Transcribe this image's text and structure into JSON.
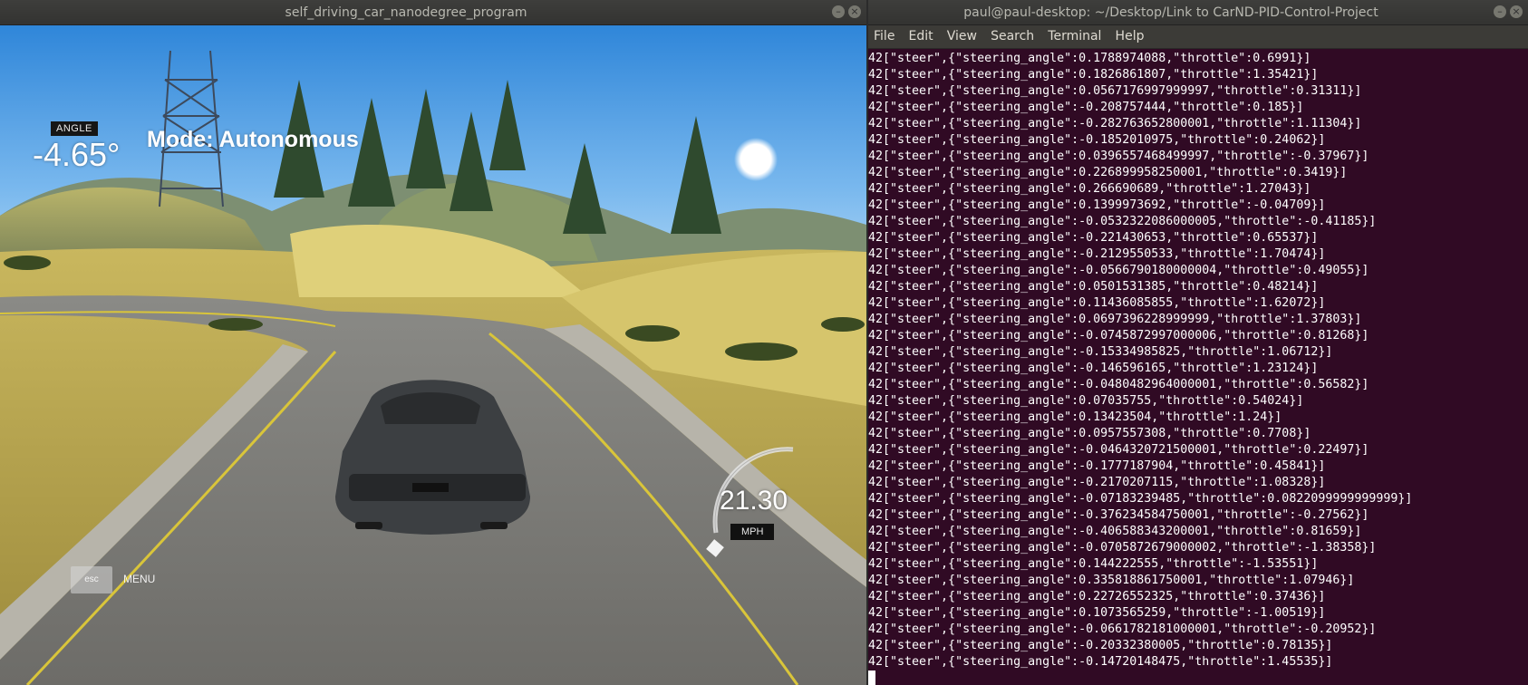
{
  "simulator": {
    "title": "self_driving_car_nanodegree_program",
    "angle_label": "ANGLE",
    "angle_value": "-4.65°",
    "mode": "Mode: Autonomous",
    "speed": "21.30",
    "speed_unit": "MPH",
    "esc_label": "esc",
    "menu_label": "MENU"
  },
  "terminal": {
    "title": "paul@paul-desktop: ~/Desktop/Link to CarND-PID-Control-Project",
    "menu": [
      "File",
      "Edit",
      "View",
      "Search",
      "Terminal",
      "Help"
    ],
    "lines": [
      "42[\"steer\",{\"steering_angle\":0.1788974088,\"throttle\":0.6991}]",
      "42[\"steer\",{\"steering_angle\":0.1826861807,\"throttle\":1.35421}]",
      "42[\"steer\",{\"steering_angle\":0.0567176997999997,\"throttle\":0.31311}]",
      "42[\"steer\",{\"steering_angle\":-0.208757444,\"throttle\":0.185}]",
      "42[\"steer\",{\"steering_angle\":-0.282763652800001,\"throttle\":1.11304}]",
      "42[\"steer\",{\"steering_angle\":-0.1852010975,\"throttle\":0.24062}]",
      "42[\"steer\",{\"steering_angle\":0.0396557468499997,\"throttle\":-0.37967}]",
      "42[\"steer\",{\"steering_angle\":0.226899958250001,\"throttle\":0.3419}]",
      "42[\"steer\",{\"steering_angle\":0.266690689,\"throttle\":1.27043}]",
      "42[\"steer\",{\"steering_angle\":0.1399973692,\"throttle\":-0.04709}]",
      "42[\"steer\",{\"steering_angle\":-0.0532322086000005,\"throttle\":-0.41185}]",
      "42[\"steer\",{\"steering_angle\":-0.221430653,\"throttle\":0.65537}]",
      "42[\"steer\",{\"steering_angle\":-0.2129550533,\"throttle\":1.70474}]",
      "42[\"steer\",{\"steering_angle\":-0.0566790180000004,\"throttle\":0.49055}]",
      "42[\"steer\",{\"steering_angle\":0.0501531385,\"throttle\":0.48214}]",
      "42[\"steer\",{\"steering_angle\":0.11436085855,\"throttle\":1.62072}]",
      "42[\"steer\",{\"steering_angle\":0.0697396228999999,\"throttle\":1.37803}]",
      "42[\"steer\",{\"steering_angle\":-0.0745872997000006,\"throttle\":0.81268}]",
      "42[\"steer\",{\"steering_angle\":-0.15334985825,\"throttle\":1.06712}]",
      "42[\"steer\",{\"steering_angle\":-0.146596165,\"throttle\":1.23124}]",
      "42[\"steer\",{\"steering_angle\":-0.0480482964000001,\"throttle\":0.56582}]",
      "42[\"steer\",{\"steering_angle\":0.07035755,\"throttle\":0.54024}]",
      "42[\"steer\",{\"steering_angle\":0.13423504,\"throttle\":1.24}]",
      "42[\"steer\",{\"steering_angle\":0.0957557308,\"throttle\":0.7708}]",
      "42[\"steer\",{\"steering_angle\":-0.0464320721500001,\"throttle\":0.22497}]",
      "42[\"steer\",{\"steering_angle\":-0.1777187904,\"throttle\":0.45841}]",
      "42[\"steer\",{\"steering_angle\":-0.2170207115,\"throttle\":1.08328}]",
      "42[\"steer\",{\"steering_angle\":-0.07183239485,\"throttle\":0.0822099999999999}]",
      "42[\"steer\",{\"steering_angle\":-0.376234584750001,\"throttle\":-0.27562}]",
      "42[\"steer\",{\"steering_angle\":-0.406588343200001,\"throttle\":0.81659}]",
      "42[\"steer\",{\"steering_angle\":-0.0705872679000002,\"throttle\":-1.38358}]",
      "42[\"steer\",{\"steering_angle\":0.144222555,\"throttle\":-1.53551}]",
      "42[\"steer\",{\"steering_angle\":0.335818861750001,\"throttle\":1.07946}]",
      "42[\"steer\",{\"steering_angle\":0.22726552325,\"throttle\":0.37436}]",
      "42[\"steer\",{\"steering_angle\":0.1073565259,\"throttle\":-1.00519}]",
      "42[\"steer\",{\"steering_angle\":-0.0661782181000001,\"throttle\":-0.20952}]",
      "42[\"steer\",{\"steering_angle\":-0.20332380005,\"throttle\":0.78135}]",
      "42[\"steer\",{\"steering_angle\":-0.14720148475,\"throttle\":1.45535}]"
    ]
  },
  "colors": {
    "terminal_bg": "#300a24",
    "titlebar_bg": "#3a3a38",
    "menubar_bg": "#3c3b37",
    "road_line_yellow": "#d9c53a"
  },
  "icons": [
    "minimize-icon",
    "close-icon",
    "speedometer-gauge-icon"
  ]
}
